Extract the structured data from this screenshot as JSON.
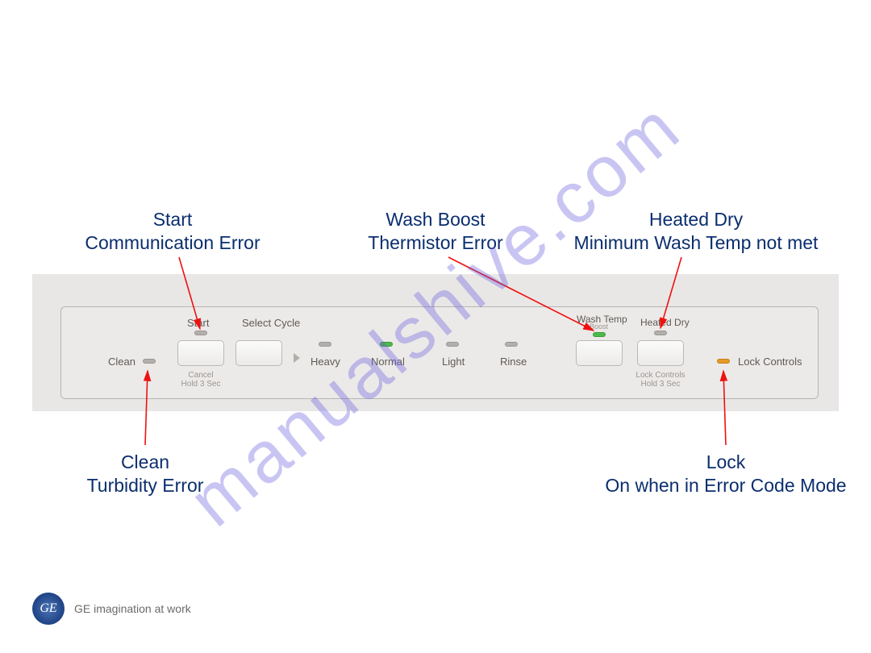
{
  "watermark": "manualshive.com",
  "annotations": {
    "start": {
      "line1": "Start",
      "line2": "Communication Error"
    },
    "washboost": {
      "line1": "Wash Boost",
      "line2": "Thermistor Error"
    },
    "heated": {
      "line1": "Heated Dry",
      "line2": "Minimum Wash Temp not met"
    },
    "clean": {
      "line1": "Clean",
      "line2": "Turbidity Error"
    },
    "lock": {
      "line1": "Lock",
      "line2": "On when in Error Code Mode"
    }
  },
  "panel": {
    "clean": "Clean",
    "start": "Start",
    "select_cycle": "Select Cycle",
    "cancel": "Cancel\nHold 3 Sec",
    "heavy": "Heavy",
    "normal": "Normal",
    "light": "Light",
    "rinse": "Rinse",
    "wash_temp": "Wash Temp",
    "wash_temp_sub": "Boost",
    "heated_dry": "Heated Dry",
    "lock_controls_sub": "Lock Controls\nHold 3 Sec",
    "lock_controls": "Lock Controls"
  },
  "footer": {
    "logo": "GE",
    "tagline": "GE imagination at work"
  }
}
